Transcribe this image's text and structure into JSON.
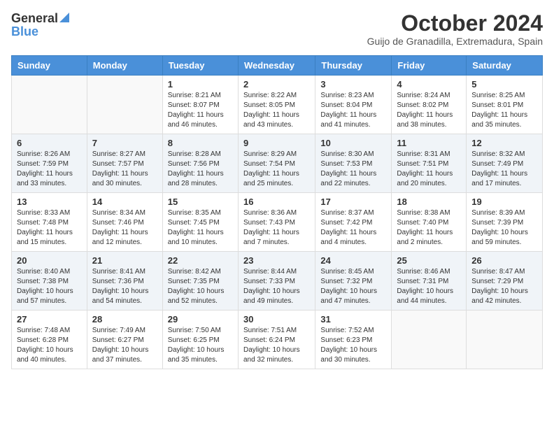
{
  "header": {
    "logo_general": "General",
    "logo_blue": "Blue",
    "title": "October 2024",
    "location": "Guijo de Granadilla, Extremadura, Spain"
  },
  "days_of_week": [
    "Sunday",
    "Monday",
    "Tuesday",
    "Wednesday",
    "Thursday",
    "Friday",
    "Saturday"
  ],
  "weeks": [
    [
      {
        "day": "",
        "info": ""
      },
      {
        "day": "",
        "info": ""
      },
      {
        "day": "1",
        "info": "Sunrise: 8:21 AM\nSunset: 8:07 PM\nDaylight: 11 hours and 46 minutes."
      },
      {
        "day": "2",
        "info": "Sunrise: 8:22 AM\nSunset: 8:05 PM\nDaylight: 11 hours and 43 minutes."
      },
      {
        "day": "3",
        "info": "Sunrise: 8:23 AM\nSunset: 8:04 PM\nDaylight: 11 hours and 41 minutes."
      },
      {
        "day": "4",
        "info": "Sunrise: 8:24 AM\nSunset: 8:02 PM\nDaylight: 11 hours and 38 minutes."
      },
      {
        "day": "5",
        "info": "Sunrise: 8:25 AM\nSunset: 8:01 PM\nDaylight: 11 hours and 35 minutes."
      }
    ],
    [
      {
        "day": "6",
        "info": "Sunrise: 8:26 AM\nSunset: 7:59 PM\nDaylight: 11 hours and 33 minutes."
      },
      {
        "day": "7",
        "info": "Sunrise: 8:27 AM\nSunset: 7:57 PM\nDaylight: 11 hours and 30 minutes."
      },
      {
        "day": "8",
        "info": "Sunrise: 8:28 AM\nSunset: 7:56 PM\nDaylight: 11 hours and 28 minutes."
      },
      {
        "day": "9",
        "info": "Sunrise: 8:29 AM\nSunset: 7:54 PM\nDaylight: 11 hours and 25 minutes."
      },
      {
        "day": "10",
        "info": "Sunrise: 8:30 AM\nSunset: 7:53 PM\nDaylight: 11 hours and 22 minutes."
      },
      {
        "day": "11",
        "info": "Sunrise: 8:31 AM\nSunset: 7:51 PM\nDaylight: 11 hours and 20 minutes."
      },
      {
        "day": "12",
        "info": "Sunrise: 8:32 AM\nSunset: 7:49 PM\nDaylight: 11 hours and 17 minutes."
      }
    ],
    [
      {
        "day": "13",
        "info": "Sunrise: 8:33 AM\nSunset: 7:48 PM\nDaylight: 11 hours and 15 minutes."
      },
      {
        "day": "14",
        "info": "Sunrise: 8:34 AM\nSunset: 7:46 PM\nDaylight: 11 hours and 12 minutes."
      },
      {
        "day": "15",
        "info": "Sunrise: 8:35 AM\nSunset: 7:45 PM\nDaylight: 11 hours and 10 minutes."
      },
      {
        "day": "16",
        "info": "Sunrise: 8:36 AM\nSunset: 7:43 PM\nDaylight: 11 hours and 7 minutes."
      },
      {
        "day": "17",
        "info": "Sunrise: 8:37 AM\nSunset: 7:42 PM\nDaylight: 11 hours and 4 minutes."
      },
      {
        "day": "18",
        "info": "Sunrise: 8:38 AM\nSunset: 7:40 PM\nDaylight: 11 hours and 2 minutes."
      },
      {
        "day": "19",
        "info": "Sunrise: 8:39 AM\nSunset: 7:39 PM\nDaylight: 10 hours and 59 minutes."
      }
    ],
    [
      {
        "day": "20",
        "info": "Sunrise: 8:40 AM\nSunset: 7:38 PM\nDaylight: 10 hours and 57 minutes."
      },
      {
        "day": "21",
        "info": "Sunrise: 8:41 AM\nSunset: 7:36 PM\nDaylight: 10 hours and 54 minutes."
      },
      {
        "day": "22",
        "info": "Sunrise: 8:42 AM\nSunset: 7:35 PM\nDaylight: 10 hours and 52 minutes."
      },
      {
        "day": "23",
        "info": "Sunrise: 8:44 AM\nSunset: 7:33 PM\nDaylight: 10 hours and 49 minutes."
      },
      {
        "day": "24",
        "info": "Sunrise: 8:45 AM\nSunset: 7:32 PM\nDaylight: 10 hours and 47 minutes."
      },
      {
        "day": "25",
        "info": "Sunrise: 8:46 AM\nSunset: 7:31 PM\nDaylight: 10 hours and 44 minutes."
      },
      {
        "day": "26",
        "info": "Sunrise: 8:47 AM\nSunset: 7:29 PM\nDaylight: 10 hours and 42 minutes."
      }
    ],
    [
      {
        "day": "27",
        "info": "Sunrise: 7:48 AM\nSunset: 6:28 PM\nDaylight: 10 hours and 40 minutes."
      },
      {
        "day": "28",
        "info": "Sunrise: 7:49 AM\nSunset: 6:27 PM\nDaylight: 10 hours and 37 minutes."
      },
      {
        "day": "29",
        "info": "Sunrise: 7:50 AM\nSunset: 6:25 PM\nDaylight: 10 hours and 35 minutes."
      },
      {
        "day": "30",
        "info": "Sunrise: 7:51 AM\nSunset: 6:24 PM\nDaylight: 10 hours and 32 minutes."
      },
      {
        "day": "31",
        "info": "Sunrise: 7:52 AM\nSunset: 6:23 PM\nDaylight: 10 hours and 30 minutes."
      },
      {
        "day": "",
        "info": ""
      },
      {
        "day": "",
        "info": ""
      }
    ]
  ]
}
